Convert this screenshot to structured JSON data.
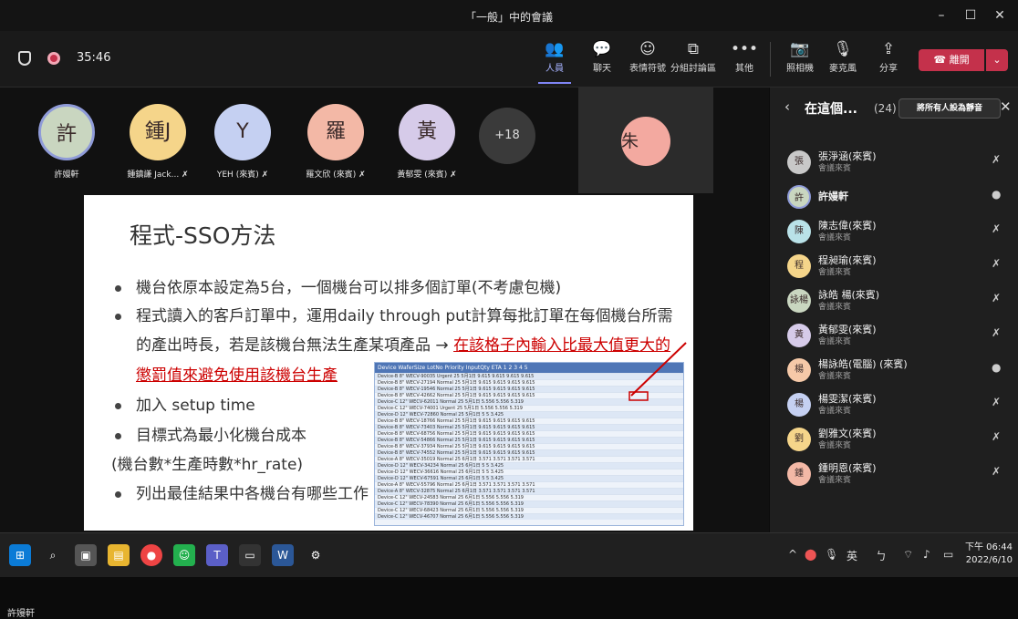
{
  "window": {
    "title": "「一般」中的會議",
    "minimize": "–",
    "maximize": "☐",
    "close": "✕"
  },
  "meeting": {
    "timer": "35:46",
    "tools": [
      {
        "label": "人員",
        "icon": "people-icon",
        "glyph": "👥"
      },
      {
        "label": "聊天",
        "icon": "chat-icon",
        "glyph": "💬"
      },
      {
        "label": "表情符號",
        "icon": "reactions-icon",
        "glyph": "☺"
      },
      {
        "label": "分組討論區",
        "icon": "breakout-rooms-icon",
        "glyph": "⧉"
      },
      {
        "label": "其他",
        "icon": "more-icon",
        "glyph": "•••"
      },
      {
        "label": "照相機",
        "icon": "camera-off-icon",
        "glyph": "📷"
      },
      {
        "label": "麥克風",
        "icon": "mic-off-icon",
        "glyph": "🎙"
      },
      {
        "label": "分享",
        "icon": "share-icon",
        "glyph": "⇪"
      }
    ],
    "leave_label": "離開"
  },
  "participants_bar": [
    {
      "initial": "許",
      "name": "許嫚軒",
      "color": "#c9d6c0",
      "muted": false
    },
    {
      "initial": "鍾J",
      "name": "鍾鎮謙 Jack...",
      "color": "#f5d58a",
      "muted": true
    },
    {
      "initial": "Y",
      "name": "YEH (來賓)",
      "color": "#c5d0f2",
      "muted": true
    },
    {
      "initial": "羅",
      "name": "羅文欣 (來賓)",
      "color": "#f3b8a6",
      "muted": true
    },
    {
      "initial": "黃",
      "name": "黃郁雯 (來賓)",
      "color": "#d6cbe9",
      "muted": true
    }
  ],
  "more_count": "+18",
  "gray_tile": {
    "initial": "朱",
    "color": "#f3a9a0"
  },
  "slide": {
    "title": "程式-SSO方法",
    "b1": "機台依原本設定為5台，一個機台可以排多個訂單(不考慮包機)",
    "b2": "程式讀入的客戶訂單中，運用daily through put計算每批訂單在每個機台所需",
    "b2b": "的產出時長，若是該機台無法生產某項產品 → ",
    "b2red": "在該格子內輸入比最大值更大的",
    "b2red2": "懲罰值來避免使用該機台生產",
    "b3": "加入 setup time",
    "b4": "目標式為最小化機台成本",
    "b5": "(機台數*生產時數*hr_rate)",
    "b6": "列出最佳結果中各機台有哪些工作",
    "table_header": "Device  WaferSize  LotNo  Priority  InputQty  ETA  1  2  3  4  5",
    "rows": [
      "Device-B 8\" WECV-90035 Urgent 25 5月1日 9.615 9.615 9.615 9.615",
      "Device-B 8\" WECV-27194 Normal 25 5月1日 9.615 9.615 9.615 9.615",
      "Device-B 8\" WECV-19546 Normal 25 5月1日 9.615 9.615 9.615 9.615",
      "Device-B 8\" WECV-42662 Normal 25 5月1日 9.615 9.615 9.615 9.615",
      "Device-C 12\" WECV-62011 Normal 25 5月1日 5.556 5.556 5.319",
      "Device-C 12\" WECV-74001 Urgent 25 5月1日 5.556 5.556 5.319",
      "Device-D 12\" WECV-72860 Normal 25 5月1日 5 5 3.425",
      "Device-B 8\" WECV-18766 Normal 25 5月1日 9.615 9.615 9.615 9.615",
      "Device-B 8\" WECV-73403 Normal 25 5月1日 9.615 9.615 9.615 9.615",
      "Device-B 8\" WECV-68756 Normal 25 5月1日 9.615 9.615 9.615 9.615",
      "Device-B 8\" WECV-54866 Normal 25 5月1日 9.615 9.615 9.615 9.615",
      "Device-B 8\" WECV-37934 Normal 25 5月1日 9.615 9.615 9.615 9.615",
      "Device-B 8\" WECV-74552 Normal 25 5月1日 9.615 9.615 9.615 9.615",
      "Device-A 8\" WECV-35019 Normal 25 6月1日 3.571 3.571 3.571 3.571",
      "Device-D 12\" WECV-34234 Normal 25 6月1日 5 5 3.425",
      "Device-D 12\" WECV-36616 Normal 25 6月1日 5 5 3.425",
      "Device-D 12\" WECV-67591 Normal 25 6月1日 5 5 3.425",
      "Device-A 8\" WECV-55796 Normal 25 6月1日 3.571 3.571 3.571 3.571",
      "Device-A 8\" WECV-32875 Normal 25 6月1日 3.571 3.571 3.571 3.571",
      "Device-C 12\" WECV-24583 Normal 25 6月1日 5.556 5.556 5.319",
      "Device-C 12\" WECV-78390 Normal 25 6月1日 5.556 5.556 5.319",
      "Device-C 12\" WECV-68423 Normal 25 6月1日 5.556 5.556 5.319",
      "Device-C 12\" WECV-46707 Normal 25 6月1日 5.556 5.556 5.319"
    ]
  },
  "presenter": "許嫚軒",
  "sidebar": {
    "title": "在這個...",
    "count": "(24)",
    "mute_all": "將所有人設為靜音",
    "people": [
      {
        "initial": "張",
        "name": "張淨涵(來賓)",
        "role": "會議來賓",
        "color": "#c8c8c8",
        "mic": "mic-off"
      },
      {
        "initial": "許",
        "name": "許嫚軒",
        "role": "",
        "color": "#c9d6c0",
        "mic": "mic-on"
      },
      {
        "initial": "陳",
        "name": "陳志偉(來賓)",
        "role": "會議來賓",
        "color": "#b9e2e8",
        "mic": "mic-off"
      },
      {
        "initial": "程",
        "name": "程昶瑜(來賓)",
        "role": "會議來賓",
        "color": "#f5d58a",
        "mic": "mic-off"
      },
      {
        "initial": "詠楊",
        "name": "詠皓 楊(來賓)",
        "role": "會議來賓",
        "color": "#c9d6c0",
        "mic": "mic-off"
      },
      {
        "initial": "黃",
        "name": "黃郁雯(來賓)",
        "role": "會議來賓",
        "color": "#d6cbe9",
        "mic": "mic-off"
      },
      {
        "initial": "楊",
        "name": "楊詠皓(電腦) (來賓)",
        "role": "會議來賓",
        "color": "#f6c9a8",
        "mic": "mic-on"
      },
      {
        "initial": "楊",
        "name": "楊雯潔(來賓)",
        "role": "會議來賓",
        "color": "#c5d0f2",
        "mic": "mic-off"
      },
      {
        "initial": "劉",
        "name": "劉雅文(來賓)",
        "role": "會議來賓",
        "color": "#f5d58a",
        "mic": "mic-off"
      },
      {
        "initial": "鍾",
        "name": "鍾明恩(來賓)",
        "role": "會議來賓",
        "color": "#f3b8a6",
        "mic": "mic-off"
      }
    ]
  },
  "taskbar": {
    "ime": "英",
    "time": "下午 06:44",
    "date": "2022/6/10"
  }
}
